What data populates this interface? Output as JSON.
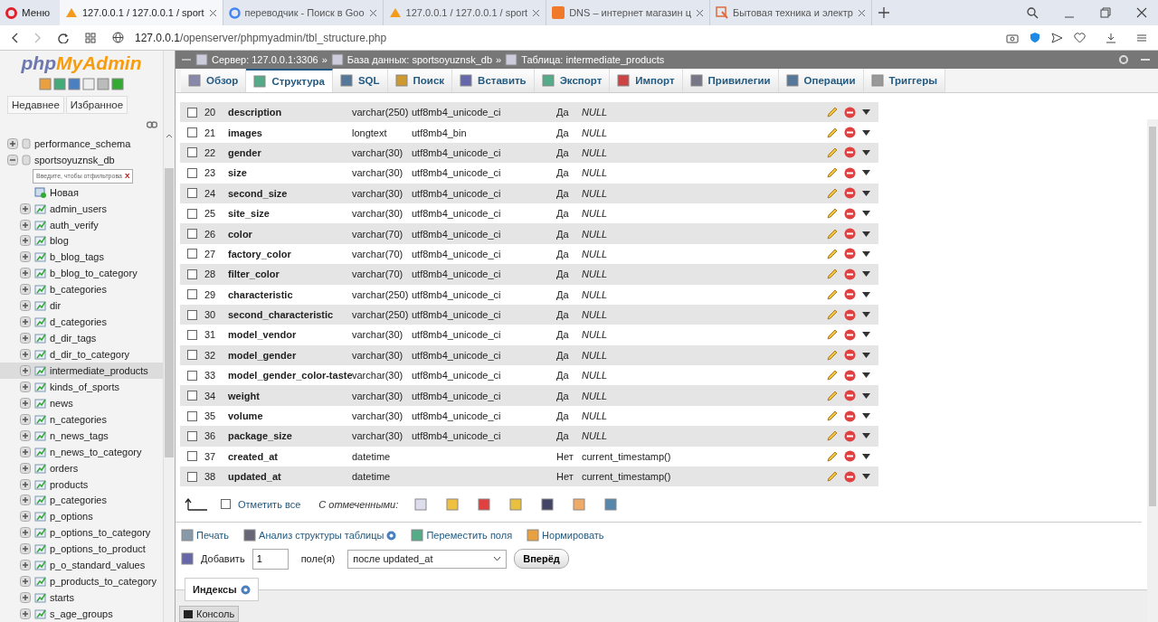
{
  "browser": {
    "menu": "Меню",
    "tabs": [
      {
        "title": "127.0.0.1 / 127.0.0.1 / sport",
        "kind": "pma",
        "selected": true
      },
      {
        "title": "переводчик - Поиск в Goo",
        "kind": "google",
        "selected": false
      },
      {
        "title": "127.0.0.1 / 127.0.0.1 / sport",
        "kind": "pma",
        "selected": false
      },
      {
        "title": "DNS – интернет магазин ц",
        "kind": "dns",
        "selected": false
      },
      {
        "title": "Бытовая техника и электр",
        "kind": "shop",
        "selected": false
      }
    ],
    "address": {
      "host": "127.0.0.1",
      "path": "/openserver/phpmyadmin/tbl_structure.php"
    }
  },
  "sidebar": {
    "logo_left": "php",
    "logo_right": "MyAdmin",
    "buttons": [
      "Недавнее",
      "Избранное"
    ],
    "tree": [
      {
        "label": "performance_schema",
        "expanded": false
      },
      {
        "label": "sportsoyuznsk_db",
        "expanded": true,
        "filter": {
          "placeholder": "Введите, чтобы отфильтрова",
          "clear": "X"
        },
        "children": [
          {
            "label": "Новая",
            "kind": "new",
            "selected": false
          },
          {
            "label": "admin_users",
            "kind": "table",
            "selected": false
          },
          {
            "label": "auth_verify",
            "kind": "table",
            "selected": false
          },
          {
            "label": "blog",
            "kind": "table",
            "selected": false
          },
          {
            "label": "b_blog_tags",
            "kind": "table",
            "selected": false
          },
          {
            "label": "b_blog_to_category",
            "kind": "table",
            "selected": false
          },
          {
            "label": "b_categories",
            "kind": "table",
            "selected": false
          },
          {
            "label": "dir",
            "kind": "table",
            "selected": false
          },
          {
            "label": "d_categories",
            "kind": "table",
            "selected": false
          },
          {
            "label": "d_dir_tags",
            "kind": "table",
            "selected": false
          },
          {
            "label": "d_dir_to_category",
            "kind": "table",
            "selected": false
          },
          {
            "label": "intermediate_products",
            "kind": "table",
            "selected": true
          },
          {
            "label": "kinds_of_sports",
            "kind": "table",
            "selected": false
          },
          {
            "label": "news",
            "kind": "table",
            "selected": false
          },
          {
            "label": "n_categories",
            "kind": "table",
            "selected": false
          },
          {
            "label": "n_news_tags",
            "kind": "table",
            "selected": false
          },
          {
            "label": "n_news_to_category",
            "kind": "table",
            "selected": false
          },
          {
            "label": "orders",
            "kind": "table",
            "selected": false
          },
          {
            "label": "products",
            "kind": "table",
            "selected": false
          },
          {
            "label": "p_categories",
            "kind": "table",
            "selected": false
          },
          {
            "label": "p_options",
            "kind": "table",
            "selected": false
          },
          {
            "label": "p_options_to_category",
            "kind": "table",
            "selected": false
          },
          {
            "label": "p_options_to_product",
            "kind": "table",
            "selected": false
          },
          {
            "label": "p_o_standard_values",
            "kind": "table",
            "selected": false
          },
          {
            "label": "p_products_to_category",
            "kind": "table",
            "selected": false
          },
          {
            "label": "starts",
            "kind": "table",
            "selected": false
          },
          {
            "label": "s_age_groups",
            "kind": "table",
            "selected": false
          }
        ]
      }
    ]
  },
  "breadcrumb": [
    "Сервер: 127.0.0.1:3306",
    "База данных: sportsoyuznsk_db",
    "Таблица: intermediate_products"
  ],
  "breadcrumb_separator": "»",
  "tabs": [
    {
      "label": "Обзор",
      "selected": false
    },
    {
      "label": "Структура",
      "selected": true
    },
    {
      "label": "SQL",
      "selected": false
    },
    {
      "label": "Поиск",
      "selected": false
    },
    {
      "label": "Вставить",
      "selected": false
    },
    {
      "label": "Экспорт",
      "selected": false
    },
    {
      "label": "Импорт",
      "selected": false
    },
    {
      "label": "Привилегии",
      "selected": false
    },
    {
      "label": "Операции",
      "selected": false
    },
    {
      "label": "Триггеры",
      "selected": false
    }
  ],
  "table": {
    "rows": [
      {
        "num": "20",
        "name": "description",
        "type": "varchar(250)",
        "collation": "utf8mb4_unicode_ci",
        "null": "Да",
        "default": "NULL",
        "checked": false
      },
      {
        "num": "21",
        "name": "images",
        "type": "longtext",
        "collation": "utf8mb4_bin",
        "null": "Да",
        "default": "NULL",
        "checked": false
      },
      {
        "num": "22",
        "name": "gender",
        "type": "varchar(30)",
        "collation": "utf8mb4_unicode_ci",
        "null": "Да",
        "default": "NULL",
        "checked": false
      },
      {
        "num": "23",
        "name": "size",
        "type": "varchar(30)",
        "collation": "utf8mb4_unicode_ci",
        "null": "Да",
        "default": "NULL",
        "checked": false
      },
      {
        "num": "24",
        "name": "second_size",
        "type": "varchar(30)",
        "collation": "utf8mb4_unicode_ci",
        "null": "Да",
        "default": "NULL",
        "checked": false
      },
      {
        "num": "25",
        "name": "site_size",
        "type": "varchar(30)",
        "collation": "utf8mb4_unicode_ci",
        "null": "Да",
        "default": "NULL",
        "checked": false
      },
      {
        "num": "26",
        "name": "color",
        "type": "varchar(70)",
        "collation": "utf8mb4_unicode_ci",
        "null": "Да",
        "default": "NULL",
        "checked": false
      },
      {
        "num": "27",
        "name": "factory_color",
        "type": "varchar(70)",
        "collation": "utf8mb4_unicode_ci",
        "null": "Да",
        "default": "NULL",
        "checked": false
      },
      {
        "num": "28",
        "name": "filter_color",
        "type": "varchar(70)",
        "collation": "utf8mb4_unicode_ci",
        "null": "Да",
        "default": "NULL",
        "checked": false
      },
      {
        "num": "29",
        "name": "characteristic",
        "type": "varchar(250)",
        "collation": "utf8mb4_unicode_ci",
        "null": "Да",
        "default": "NULL",
        "checked": false
      },
      {
        "num": "30",
        "name": "second_characteristic",
        "type": "varchar(250)",
        "collation": "utf8mb4_unicode_ci",
        "null": "Да",
        "default": "NULL",
        "checked": false
      },
      {
        "num": "31",
        "name": "model_vendor",
        "type": "varchar(30)",
        "collation": "utf8mb4_unicode_ci",
        "null": "Да",
        "default": "NULL",
        "checked": false
      },
      {
        "num": "32",
        "name": "model_gender",
        "type": "varchar(30)",
        "collation": "utf8mb4_unicode_ci",
        "null": "Да",
        "default": "NULL",
        "checked": false
      },
      {
        "num": "33",
        "name": "model_gender_color-taste",
        "type": "varchar(30)",
        "collation": "utf8mb4_unicode_ci",
        "null": "Да",
        "default": "NULL",
        "checked": false
      },
      {
        "num": "34",
        "name": "weight",
        "type": "varchar(30)",
        "collation": "utf8mb4_unicode_ci",
        "null": "Да",
        "default": "NULL",
        "checked": false
      },
      {
        "num": "35",
        "name": "volume",
        "type": "varchar(30)",
        "collation": "utf8mb4_unicode_ci",
        "null": "Да",
        "default": "NULL",
        "checked": false
      },
      {
        "num": "36",
        "name": "package_size",
        "type": "varchar(30)",
        "collation": "utf8mb4_unicode_ci",
        "null": "Да",
        "default": "NULL",
        "checked": false
      },
      {
        "num": "37",
        "name": "created_at",
        "type": "datetime",
        "null": "Нет",
        "default": "current_timestamp()",
        "null_default": false,
        "checked": false
      },
      {
        "num": "38",
        "name": "updated_at",
        "type": "datetime",
        "null": "Нет",
        "default": "current_timestamp()",
        "null_default": false,
        "checked": false
      }
    ]
  },
  "bulk": {
    "select_all": {
      "label": "Отметить все",
      "checked": false
    },
    "with_selected": "С отмеченными:"
  },
  "links": [
    "Печать",
    "Анализ структуры таблицы",
    "Переместить поля",
    "Нормировать"
  ],
  "add": {
    "label": "Добавить",
    "count": "1",
    "unit": "поле(я)",
    "position": "после updated_at",
    "submit": "Вперёд"
  },
  "indexes": "Индексы",
  "console": "Консоль"
}
